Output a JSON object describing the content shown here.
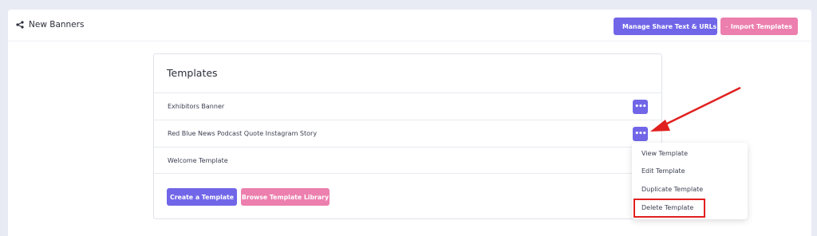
{
  "header": {
    "title": "New Banners",
    "share_button_label": "Manage Share Text & URLs",
    "import_button_label": "Import Templates"
  },
  "templates": {
    "heading": "Templates",
    "items": [
      {
        "name": "Exhibitors Banner",
        "actions": "•••"
      },
      {
        "name": "Red Blue News Podcast Quote Instagram Story",
        "actions": "•••"
      },
      {
        "name": "Welcome Template",
        "actions": "•••"
      }
    ],
    "create_label": "Create a Template",
    "browse_label": "Browse Template Library"
  },
  "context_menu": {
    "items": [
      "View Template",
      "Edit Template",
      "Duplicate Template",
      "Delete Template"
    ],
    "highlighted": "Delete Template"
  },
  "colors": {
    "primary": "#7166e8",
    "pink": "#ec7fae",
    "annotation_red": "#e0201f",
    "background": "#e9ebf4"
  }
}
